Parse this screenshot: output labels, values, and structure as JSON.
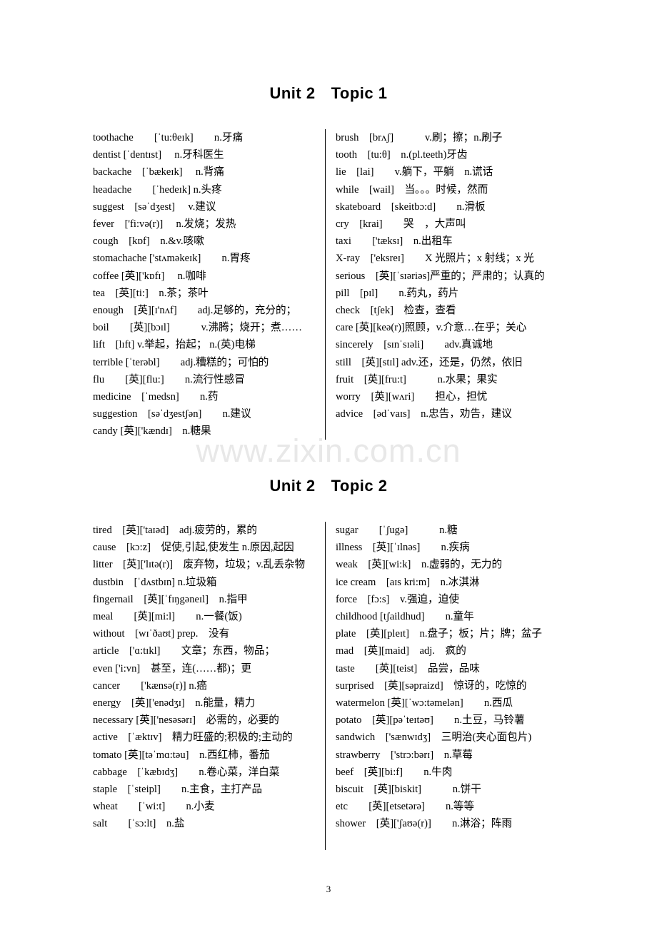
{
  "document": {
    "page_number": "3",
    "watermark": "www.zixin.com.cn"
  },
  "sections": [
    {
      "heading_unit": "Unit 2",
      "heading_topic": "Topic 1",
      "left_column": [
        "toothache　　[ˈtu:θeɪk]　　n.牙痛",
        "dentist [ˈdentɪst]　 n.牙科医生",
        "backache　[ˈbækeɪk]　 n.背痛",
        "headache　　[ˈhedeɪk] n.头疼",
        "suggest　[səˈdʒest]　 v.建议",
        "fever　['fi:və(r)]　 n.发烧；发热",
        "cough　[kɒf]　n.&v.咳嗽",
        "stomachache ['stʌməkeɪk]　　n.胃疼",
        "coffee [英]['kɒfɪ]　 n.咖啡",
        "tea　[英][ti:]　n.茶；茶叶",
        "enough　[英][ɪ'nʌf]　　adj.足够的，充分的；",
        "boil　　[英][bɔɪl]　　　v.沸腾；烧开；煮……",
        "lift　[lɪft] v.举起，抬起； n.(英)电梯",
        "terrible [ˈterəbl]　　adj.糟糕的；可怕的",
        "flu　　[英][flu:]　　n.流行性感冒",
        "medicine　[ˈmedsn]　　n.药",
        "suggestion　[səˈdʒestʃən]　　n.建议",
        "candy [英]['kændɪ]　n.糖果"
      ],
      "right_column": [
        "brush　[brʌʃ]　　　v.刷；擦；n.刷子",
        "tooth　[tu:θ]　n.(pl.teeth)牙齿",
        "lie　[lai]　　v.躺下，平躺　n.谎话",
        "while　[wail]　当。。。时候，然而",
        "skateboard　[skeitbɔ:d]　　n.滑板",
        "cry　[krai]　　哭　，大声叫",
        "taxi　　['tæksɪ]　n.出租车",
        "X-ray　['eksreɪ]　　X 光照片；x 射线；x 光",
        "serious　[英][ˈsɪəriəs]严重的；严肃的；认真的",
        "pill　[pɪl]　　n.药丸，药片",
        "check　[tʃek]　检查，查看",
        "care [英][keə(r)]照顾，v.介意…在乎；关心",
        "sincerely　[sɪnˈsɪəli]　　adv.真诚地",
        "still　[英][stɪl] adv.还，还是，仍然，依旧",
        "fruit　[英][fru:t]　　　n.水果；果实",
        "worry　[英][wʌri]　　担心，担忧",
        "advice　[ədˈvaɪs]　n.忠告，劝告，建议"
      ]
    },
    {
      "heading_unit": "Unit 2",
      "heading_topic": "Topic 2",
      "left_column": [
        "tired　[英]['taɪəd]　adj.疲劳的，累的",
        "cause　[kɔ:z]　促使,引起,使发生 n.原因,起因",
        "litter　[英]['lɪtə(r)]　废弃物，垃圾；v.乱丢杂物",
        "dustbin　[ˈdʌstbɪn] n.垃圾箱",
        "fingernail　[英][ˈfɪŋgəneɪl]　n.指甲",
        "meal　　[英][mi:l]　　n.一餐(饭)",
        "without　[wɪˈðaʊt] prep.　没有",
        "article　['ɑ:tɪkl]　　文章；东西，物品；",
        "even ['i:vn]　甚至，连(……都)；更",
        "cancer　　['kænsə(r)] n.癌",
        "energy　[英]['enədʒɪ]　n.能量，精力",
        "necessary [英]['nesəsərɪ]　必需的，必要的",
        "active　[ˈæktɪv]　精力旺盛的;积极的;主动的",
        "tomato [英][təˈmɑ:təu]　n.西红柿，番茄",
        "cabbage　[ˈkæbɪdʒ]　　n.卷心菜，洋白菜",
        "staple　[ˈsteipl]　　n.主食，主打产品",
        "wheat　　[ˈwi:t]　　n.小麦",
        "salt　　[ˈsɔ:lt]　n.盐"
      ],
      "right_column": [
        "sugar　　[ˈʃugə]　　　n.糖",
        "illness　[英][ˈɪlnəs]　　n.疾病",
        "weak　[英][wi:k]　n.虚弱的，无力的",
        "ice cream　[aɪs kri:m]　n.冰淇淋",
        "force　[fɔ:s]　v.强迫，迫使",
        "childhood [tʃaildhud]　　n.童年",
        "plate　[英][pleɪt]　n.盘子；板；片；牌；盆子",
        "mad　[英][maid]　adj.　疯的",
        "taste　　[英][teist]　品尝，品味",
        "surprised　[英][səpraizd]　惊讶的，吃惊的",
        "watermelon [英][ˈwɔ:təmelən]　　n.西瓜",
        "potato　[英][pəˈteɪtəʊ]　　n.土豆，马铃薯",
        "sandwich　['sænwɪdʒ]　三明治(夹心面包片)",
        "strawberry　['strɔ:bərɪ]　n.草莓",
        "beef　[英][bi:f]　　n.牛肉",
        "biscuit　[英][biskit]　　　n.饼干",
        "etc　　[英][etsetərə]　　n.等等",
        "shower　[英]['ʃaʊə(r)]　　n.淋浴；阵雨"
      ]
    }
  ]
}
